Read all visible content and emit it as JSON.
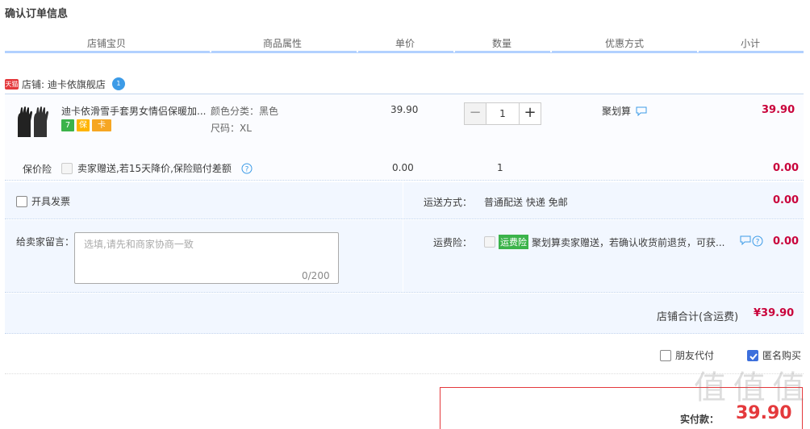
{
  "page_title": "确认订单信息",
  "columns": [
    "店铺宝贝",
    "商品属性",
    "单价",
    "数量",
    "优惠方式",
    "小计"
  ],
  "shop": {
    "badge": "天猫",
    "label": "店铺: 迪卡依旗舰店",
    "chat_count": "1"
  },
  "item": {
    "title": "迪卡依滑雪手套男女情侣保暖加...",
    "badges": [
      "7",
      "保",
      "卡"
    ],
    "attr_color": "颜色分类：黑色",
    "attr_size": "尺码：XL",
    "price": "39.90",
    "quantity": "1",
    "qty_minus": "−",
    "qty_plus": "+",
    "discount": "聚划算",
    "subtotal": "39.90"
  },
  "insurance": {
    "label": "保价险",
    "text": "卖家赠送,若15天降价,保险赔付差额",
    "price": "0.00",
    "quantity": "1",
    "subtotal": "0.00"
  },
  "invoice": {
    "label": "开具发票"
  },
  "shipping": {
    "label": "运送方式：",
    "value": "普通配送 快递 免邮",
    "price": "0.00"
  },
  "message": {
    "label": "给卖家留言：",
    "placeholder": "选填,请先和商家协商一致",
    "count": "0/200"
  },
  "freight_insurance": {
    "label": "运费险：",
    "tag": "运费险",
    "text": "聚划算卖家赠送，若确认收货前退货，可获...",
    "price": "0.00"
  },
  "shop_total": {
    "label": "店铺合计(含运费)",
    "value": "¥39.90"
  },
  "options": {
    "friend_pay": "朋友代付",
    "anonymous": "匿名购买"
  },
  "pay": {
    "label": "实付款：",
    "value": "39.90"
  },
  "watermark": "值 值 值",
  "colors": {
    "price_red": "#c9033b",
    "header_line": "#b2d1ff",
    "row_bg": "#f2f7ff",
    "green": "#3bb34a"
  }
}
